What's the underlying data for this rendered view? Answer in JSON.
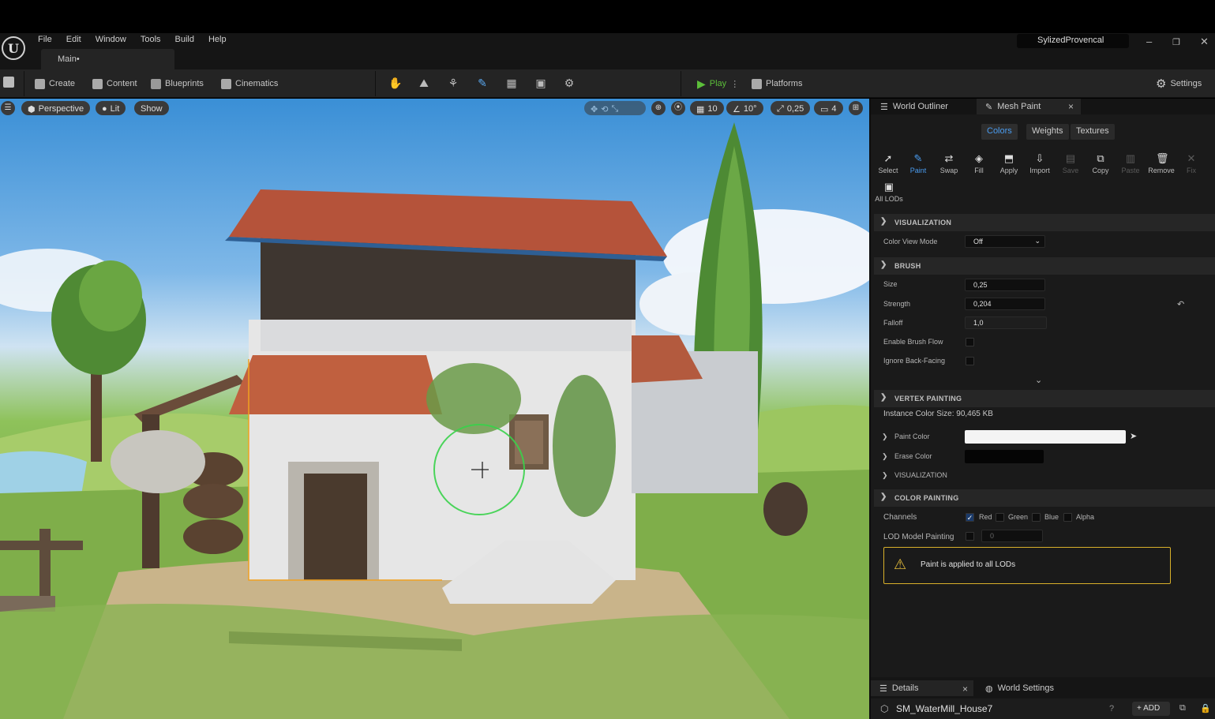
{
  "window": {
    "project_name": "SylizedProvencal",
    "minimize": "–",
    "maximize": "❐",
    "close": "✕",
    "logo": "U"
  },
  "menu": [
    "File",
    "Edit",
    "Window",
    "Tools",
    "Build",
    "Help"
  ],
  "doc_tab": "Main•",
  "toolbar": {
    "create": "Create",
    "content": "Content",
    "blueprints": "Blueprints",
    "cinematics": "Cinematics",
    "play": "Play",
    "platforms": "Platforms",
    "settings": "Settings"
  },
  "viewport": {
    "perspective": "Perspective",
    "lit": "Lit",
    "show": "Show",
    "grid_snap": "10",
    "angle_snap": "10°",
    "scale_snap": "0,25",
    "camera_speed": "4"
  },
  "panel_tabs": {
    "outliner": "World Outliner",
    "mesh_paint": "Mesh Paint",
    "close": "×"
  },
  "paint_tabs": [
    "Colors",
    "Weights",
    "Textures"
  ],
  "tools": [
    {
      "label": "Select",
      "icon": "➚"
    },
    {
      "label": "Paint",
      "icon": "✎"
    },
    {
      "label": "Swap",
      "icon": "⇄"
    },
    {
      "label": "Fill",
      "icon": "◈"
    },
    {
      "label": "Apply",
      "icon": "⬒"
    },
    {
      "label": "Import",
      "icon": "⇩"
    },
    {
      "label": "Save",
      "icon": "▤"
    },
    {
      "label": "Copy",
      "icon": "⧉"
    },
    {
      "label": "Paste",
      "icon": "▥"
    },
    {
      "label": "Remove",
      "icon": "🗑"
    },
    {
      "label": "Fix",
      "icon": "✕"
    }
  ],
  "all_lods": "All LODs",
  "visualization": {
    "header": "VISUALIZATION",
    "color_view_mode_label": "Color View Mode",
    "color_view_mode_value": "Off"
  },
  "brush": {
    "header": "BRUSH",
    "size_label": "Size",
    "size_value": "0,25",
    "strength_label": "Strength",
    "strength_value": "0,204",
    "falloff_label": "Falloff",
    "falloff_value": "1,0",
    "brush_flow_label": "Enable Brush Flow",
    "back_facing_label": "Ignore Back-Facing"
  },
  "vertex_painting": {
    "header": "VERTEX PAINTING",
    "instance_size": "Instance Color Size: 90,465 KB",
    "paint_color_label": "Paint Color",
    "erase_color_label": "Erase Color",
    "visualization_label": "VISUALIZATION"
  },
  "color_painting": {
    "header": "COLOR PAINTING",
    "channels_label": "Channels",
    "red": "Red",
    "green": "Green",
    "blue": "Blue",
    "alpha": "Alpha",
    "lod_label": "LOD Model Painting",
    "lod_value": "0"
  },
  "warning": "Paint is applied to all LODs",
  "bottom": {
    "details": "Details",
    "close": "×",
    "world_settings": "World Settings",
    "actor": "SM_WaterMill_House7",
    "add": "ADD"
  },
  "colors": {
    "accent": "#4a9cf0",
    "play_green": "#5cbf3a",
    "warning": "#d8b02a",
    "brush_ring": "#39d24a"
  }
}
